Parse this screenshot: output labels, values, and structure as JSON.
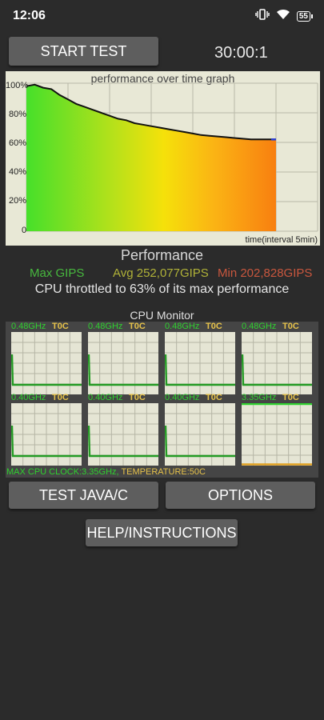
{
  "status_bar": {
    "time": "12:06",
    "battery_level": "55",
    "icons": [
      "vibrate-icon",
      "wifi-icon",
      "battery-icon"
    ]
  },
  "controls": {
    "start_test_label": "START TEST",
    "timer": "30:00:1",
    "test_java_label": "TEST JAVA/C",
    "options_label": "OPTIONS",
    "help_label": "HELP/INSTRUCTIONS"
  },
  "chart_data": {
    "type": "line",
    "title": "performance over time graph",
    "xlabel": "time(interval 5min)",
    "ylabel": "",
    "y_tick_labels": [
      "100%",
      "80%",
      "60%",
      "40%",
      "20%",
      "0"
    ],
    "ylim": [
      0,
      100
    ],
    "x_range_minutes": [
      0,
      30
    ],
    "x_grid_interval_minutes": 5,
    "grid": true,
    "fill": "gradient green to orange under line",
    "series": [
      {
        "values_by_minute": [
          [
            0,
            98
          ],
          [
            1,
            99
          ],
          [
            2,
            97
          ],
          [
            3,
            96
          ],
          [
            4,
            92
          ],
          [
            5,
            89
          ],
          [
            6,
            86
          ],
          [
            7,
            84
          ],
          [
            8,
            82
          ],
          [
            9,
            80
          ],
          [
            10,
            78
          ],
          [
            11,
            76
          ],
          [
            12,
            75
          ],
          [
            13,
            73
          ],
          [
            14,
            72
          ],
          [
            15,
            71
          ],
          [
            16,
            70
          ],
          [
            17,
            69
          ],
          [
            18,
            68
          ],
          [
            19,
            67
          ],
          [
            20,
            66
          ],
          [
            21,
            65
          ],
          [
            22,
            64.5
          ],
          [
            23,
            64
          ],
          [
            24,
            63.5
          ],
          [
            25,
            63
          ],
          [
            26,
            62.5
          ],
          [
            27,
            62
          ],
          [
            28,
            62
          ],
          [
            29,
            62
          ],
          [
            30,
            62
          ]
        ]
      }
    ]
  },
  "performance": {
    "heading": "Performance",
    "max": "Max GIPS",
    "avg": "Avg 252,077GIPS",
    "min": "Min 202,828GIPS",
    "throttle_text": "CPU throttled to 63% of its max performance"
  },
  "cpu_monitor": {
    "title": "CPU Monitor",
    "cores": [
      {
        "freq": "0.48GHz",
        "temp": "T0C",
        "trace": "drop"
      },
      {
        "freq": "0.48GHz",
        "temp": "T0C",
        "trace": "drop"
      },
      {
        "freq": "0.48GHz",
        "temp": "T0C",
        "trace": "drop"
      },
      {
        "freq": "0.48GHz",
        "temp": "T0C",
        "trace": "drop"
      },
      {
        "freq": "0.40GHz",
        "temp": "T0C",
        "trace": "drop"
      },
      {
        "freq": "0.40GHz",
        "temp": "T0C",
        "trace": "drop"
      },
      {
        "freq": "0.40GHz",
        "temp": "T0C",
        "trace": "drop"
      },
      {
        "freq": "3.35GHz",
        "temp": "T0C",
        "trace": "max"
      }
    ],
    "summary_clock": "MAX CPU CLOCK:3.35GHz,",
    "summary_temp": " TEMPERATURE:50C"
  },
  "colors": {
    "background": "#2b2b2b",
    "button": "#5e5e5e",
    "graph_bg": "#e8e8d6",
    "max_green": "#47b83e",
    "avg_yellow": "#b0b238",
    "min_red": "#c9573e",
    "core_green": "#2fd12f",
    "core_yellow": "#e6c24a"
  }
}
